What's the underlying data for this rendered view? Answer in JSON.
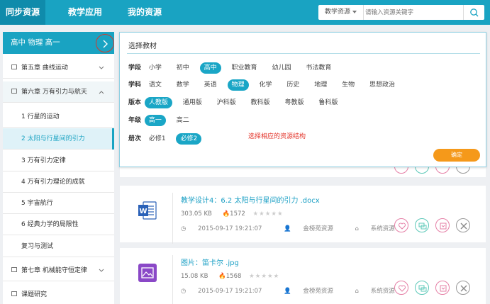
{
  "nav": {
    "tabs": [
      {
        "label": "同步资源"
      },
      {
        "label": "教学应用"
      },
      {
        "label": "我的资源"
      }
    ],
    "search": {
      "category": "教学资源",
      "placeholder": "请输入资源关键字"
    }
  },
  "sidebar": {
    "header": "高中 物理 高一",
    "items": [
      {
        "label": "第五章 曲线运动"
      },
      {
        "label": "第六章 万有引力与航天"
      },
      {
        "label": "1 行星的运动"
      },
      {
        "label": "2 太阳与行星间的引力"
      },
      {
        "label": "3 万有引力定律"
      },
      {
        "label": "4 万有引力理论的成就"
      },
      {
        "label": "5 宇宙航行"
      },
      {
        "label": "6 经典力学的局限性"
      },
      {
        "label": "复习与测试"
      },
      {
        "label": "第七章 机械能守恒定律"
      },
      {
        "label": "课题研究"
      }
    ]
  },
  "picker": {
    "title": "选择教材",
    "rows": [
      {
        "label": "学段",
        "options": [
          "小学",
          "初中",
          "高中",
          "职业教育",
          "幼儿园",
          "书法教育"
        ]
      },
      {
        "label": "学科",
        "options": [
          "语文",
          "数学",
          "英语",
          "物理",
          "化学",
          "历史",
          "地理",
          "生物",
          "思想政治"
        ]
      },
      {
        "label": "版本",
        "options": [
          "人教版",
          "通用版",
          "沪科版",
          "教科版",
          "粤教版",
          "鲁科版"
        ]
      },
      {
        "label": "年级",
        "options": [
          "高一",
          "高二"
        ]
      },
      {
        "label": "册次",
        "options": [
          "必修1",
          "必修2"
        ]
      }
    ],
    "hint": "选择相应的资源结构",
    "confirm": "确定"
  },
  "resources": [
    {
      "title": "教学设计4：6.2 太阳与行星间的引力 .docx",
      "size": "303.05 KB",
      "downloads": "1572",
      "date": "2015-09-17 19:21:07",
      "author": "金榜苑资源",
      "source": "系统资源",
      "icon": "word-file-icon",
      "color": "#2b62b8"
    },
    {
      "title": "图片：笛卡尔 .jpg",
      "size": "15.08 KB",
      "downloads": "1568",
      "date": "2015-09-17 19:21:07",
      "author": "金榜苑资源",
      "source": "系统资源",
      "icon": "image-file-icon",
      "color": "#8a48c7"
    }
  ]
}
